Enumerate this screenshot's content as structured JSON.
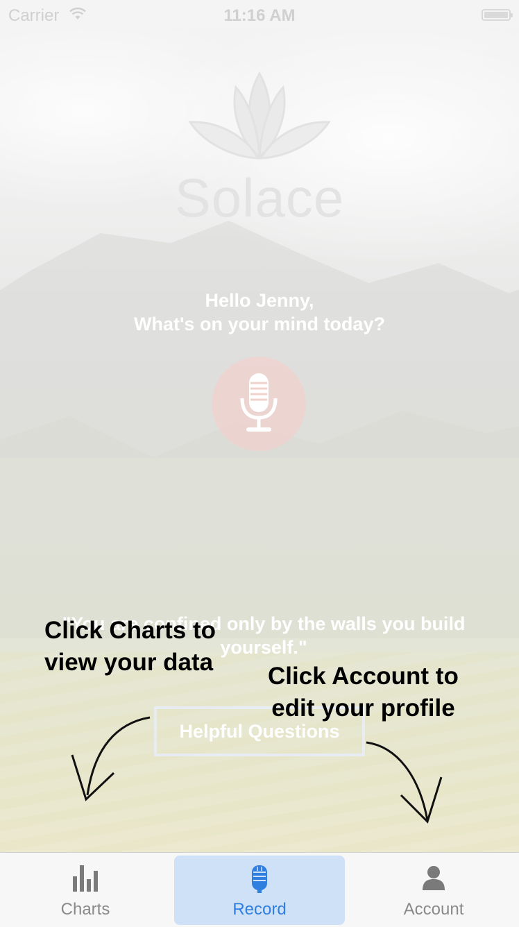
{
  "status_bar": {
    "carrier": "Carrier",
    "time": "11:16 AM"
  },
  "app": {
    "name": "Solace"
  },
  "greeting": {
    "line1": "Hello Jenny,",
    "line2": "What's on your mind today?"
  },
  "quote": {
    "text": "\"You are confined only by the walls you build yourself.\""
  },
  "helpful_button": {
    "label": "Helpful Questions"
  },
  "overlay_hints": {
    "charts": {
      "line1": "Click Charts to",
      "line2": "view your data"
    },
    "account": {
      "line1": "Click Account to",
      "line2": "edit your profile"
    }
  },
  "tabs": [
    {
      "label": "Charts",
      "icon": "bar-chart-icon",
      "selected": false
    },
    {
      "label": "Record",
      "icon": "microphone-icon",
      "selected": true
    },
    {
      "label": "Account",
      "icon": "person-icon",
      "selected": false
    }
  ],
  "colors": {
    "accent": "#2f7fe0",
    "selected_tab_bg": "#cfe1f7",
    "mic_bg": "#f0d2cd"
  }
}
